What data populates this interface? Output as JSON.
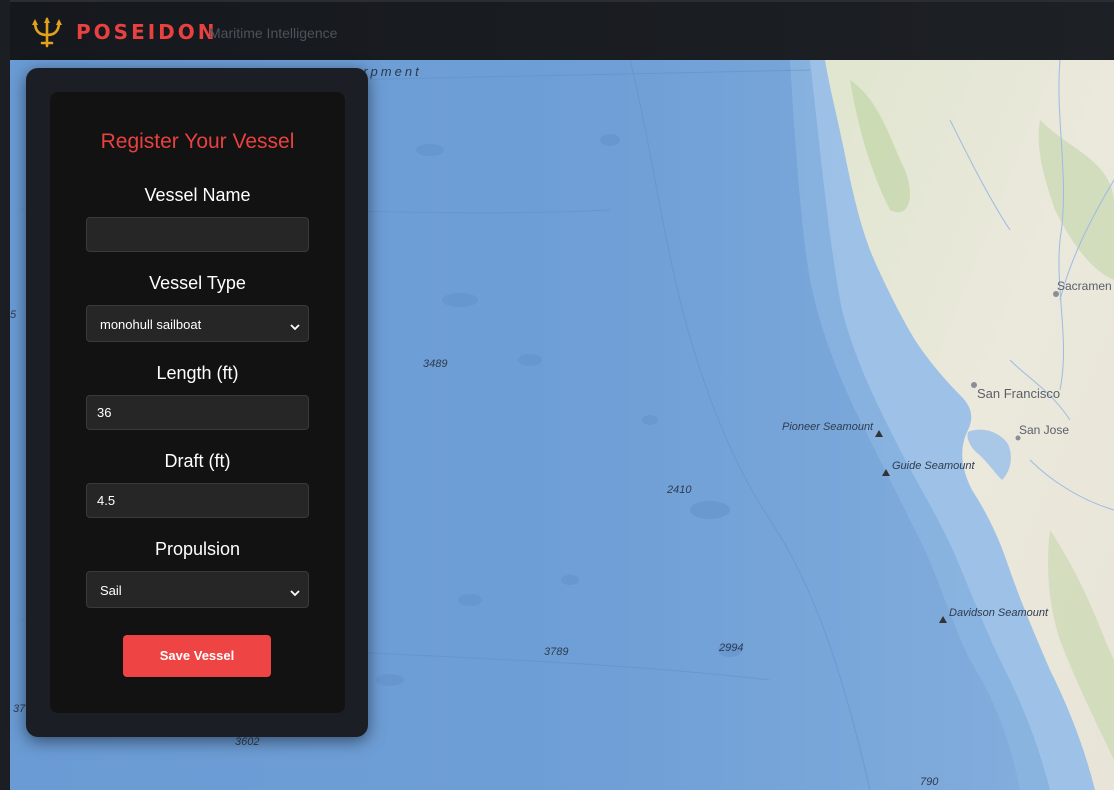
{
  "header": {
    "brand": "POSEIDON",
    "tagline": "Maritime Intelligence",
    "logo_icon": "trident-icon",
    "brand_color": "#e8413f"
  },
  "map": {
    "ocean_color": "#6f9fd6",
    "land_color": "#ebe7dc",
    "labels": {
      "escarpment": "arpment",
      "depth_3489": "3489",
      "depth_2410": "2410",
      "depth_3789": "3789",
      "depth_2994": "2994",
      "depth_3602": "3602",
      "depth_790": "790",
      "depth_37": "37",
      "edge_5": "5",
      "pioneer": "Pioneer Seamount",
      "guide": "Guide Seamount",
      "davidson": "Davidson Seamount",
      "sacramento": "Sacramen",
      "san_francisco": "San Francisco",
      "san_jose": "San Jose"
    }
  },
  "form": {
    "title": "Register Your Vessel",
    "vessel_name": {
      "label": "Vessel Name",
      "value": "",
      "placeholder": ""
    },
    "vessel_type": {
      "label": "Vessel Type",
      "value": "monohull sailboat"
    },
    "length": {
      "label": "Length (ft)",
      "value": "36"
    },
    "draft": {
      "label": "Draft (ft)",
      "value": "4.5"
    },
    "propulsion": {
      "label": "Propulsion",
      "value": "Sail"
    },
    "save_label": "Save Vessel",
    "accent_color": "#ef4444"
  }
}
